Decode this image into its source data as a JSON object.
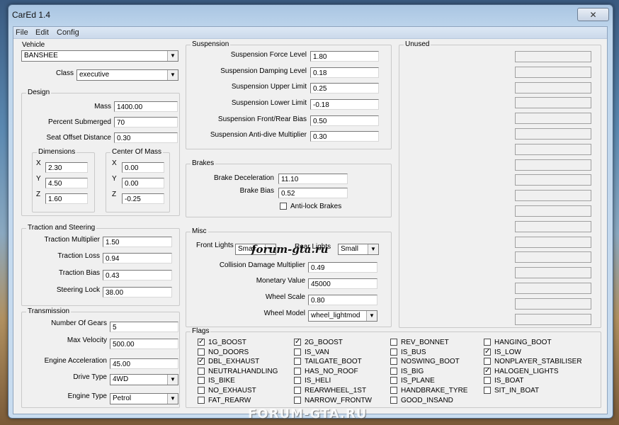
{
  "window": {
    "title": "CarEd 1.4",
    "close_glyph": "✕"
  },
  "menu": [
    "File",
    "Edit",
    "Config"
  ],
  "vehicle": {
    "group_label": "Vehicle",
    "selected": "BANSHEE",
    "class_label": "Class",
    "class_value": "executive"
  },
  "design": {
    "label": "Design",
    "fields": [
      {
        "label": "Mass",
        "value": "1400.00"
      },
      {
        "label": "Percent Submerged",
        "value": "70"
      },
      {
        "label": "Seat Offset Distance",
        "value": "0.30"
      }
    ],
    "dimensions": {
      "label": "Dimensions",
      "x": "2.30",
      "y": "4.50",
      "z": "1.60"
    },
    "center_of_mass": {
      "label": "Center Of Mass",
      "x": "0.00",
      "y": "0.00",
      "z": "-0.25"
    },
    "axis_labels": [
      "X",
      "Y",
      "Z"
    ]
  },
  "traction": {
    "label": "Traction and Steering",
    "fields": [
      {
        "label": "Traction Multiplier",
        "value": "1.50"
      },
      {
        "label": "Traction Loss",
        "value": "0.94"
      },
      {
        "label": "Traction Bias",
        "value": "0.43"
      },
      {
        "label": "Steering Lock",
        "value": "38.00"
      }
    ]
  },
  "transmission": {
    "label": "Transmission",
    "fields": [
      {
        "label": "Number Of Gears",
        "value": "5"
      },
      {
        "label": "Max Velocity",
        "value": "500.00"
      },
      {
        "label": "Engine Acceleration",
        "value": "45.00"
      }
    ],
    "drive_type_label": "Drive Type",
    "drive_type": "4WD",
    "engine_type_label": "Engine Type",
    "engine_type": "Petrol"
  },
  "suspension": {
    "label": "Suspension",
    "fields": [
      {
        "label": "Suspension Force Level",
        "value": "1.80"
      },
      {
        "label": "Suspension Damping Level",
        "value": "0.18"
      },
      {
        "label": "Suspension Upper Limit",
        "value": "0.25"
      },
      {
        "label": "Suspension Lower Limit",
        "value": "-0.18"
      },
      {
        "label": "Suspension Front/Rear Bias",
        "value": "0.50"
      },
      {
        "label": "Suspension Anti-dive Multiplier",
        "value": "0.30"
      }
    ]
  },
  "brakes": {
    "label": "Brakes",
    "fields": [
      {
        "label": "Brake Deceleration",
        "value": "11.10"
      },
      {
        "label": "Brake Bias",
        "value": "0.52"
      }
    ],
    "abs_label": "Anti-lock Brakes",
    "abs_checked": false
  },
  "misc": {
    "label": "Misc",
    "front_lights_label": "Front Lights",
    "front_lights": "Small",
    "rear_lights_label": "Rear Lights",
    "rear_lights": "Small",
    "fields": [
      {
        "label": "Collision Damage Multiplier",
        "value": "0.49"
      },
      {
        "label": "Monetary Value",
        "value": "45000"
      },
      {
        "label": "Wheel Scale",
        "value": "0.80"
      }
    ],
    "wheel_model_label": "Wheel Model",
    "wheel_model": "wheel_lightmod"
  },
  "unused": {
    "label": "Unused"
  },
  "flags": {
    "label": "Flags",
    "columns": [
      [
        {
          "name": "1G_BOOST",
          "checked": true
        },
        {
          "name": "NO_DOORS",
          "checked": false
        },
        {
          "name": "DBL_EXHAUST",
          "checked": true
        },
        {
          "name": "NEUTRALHANDLING",
          "checked": false
        },
        {
          "name": "IS_BIKE",
          "checked": false
        },
        {
          "name": "NO_EXHAUST",
          "checked": false
        },
        {
          "name": "FAT_REARW",
          "checked": false
        }
      ],
      [
        {
          "name": "2G_BOOST",
          "checked": true
        },
        {
          "name": "IS_VAN",
          "checked": false
        },
        {
          "name": "TAILGATE_BOOT",
          "checked": false
        },
        {
          "name": "HAS_NO_ROOF",
          "checked": false
        },
        {
          "name": "IS_HELI",
          "checked": false
        },
        {
          "name": "REARWHEEL_1ST",
          "checked": false
        },
        {
          "name": "NARROW_FRONTW",
          "checked": false
        }
      ],
      [
        {
          "name": "REV_BONNET",
          "checked": false
        },
        {
          "name": "IS_BUS",
          "checked": false
        },
        {
          "name": "NOSWING_BOOT",
          "checked": false
        },
        {
          "name": "IS_BIG",
          "checked": false
        },
        {
          "name": "IS_PLANE",
          "checked": false
        },
        {
          "name": "HANDBRAKE_TYRE",
          "checked": false
        },
        {
          "name": "GOOD_INSAND",
          "checked": false
        }
      ],
      [
        {
          "name": "HANGING_BOOT",
          "checked": false
        },
        {
          "name": "IS_LOW",
          "checked": true
        },
        {
          "name": "NONPLAYER_STABILISER",
          "checked": false
        },
        {
          "name": "HALOGEN_LIGHTS",
          "checked": true
        },
        {
          "name": "IS_BOAT",
          "checked": false
        },
        {
          "name": "SIT_IN_BOAT",
          "checked": false
        }
      ]
    ]
  },
  "watermarks": {
    "top": "forum-gta.ru",
    "bottom": "FORUM-GTA.RU"
  },
  "glyphs": {
    "dropdown": "▼",
    "check": "✓"
  }
}
